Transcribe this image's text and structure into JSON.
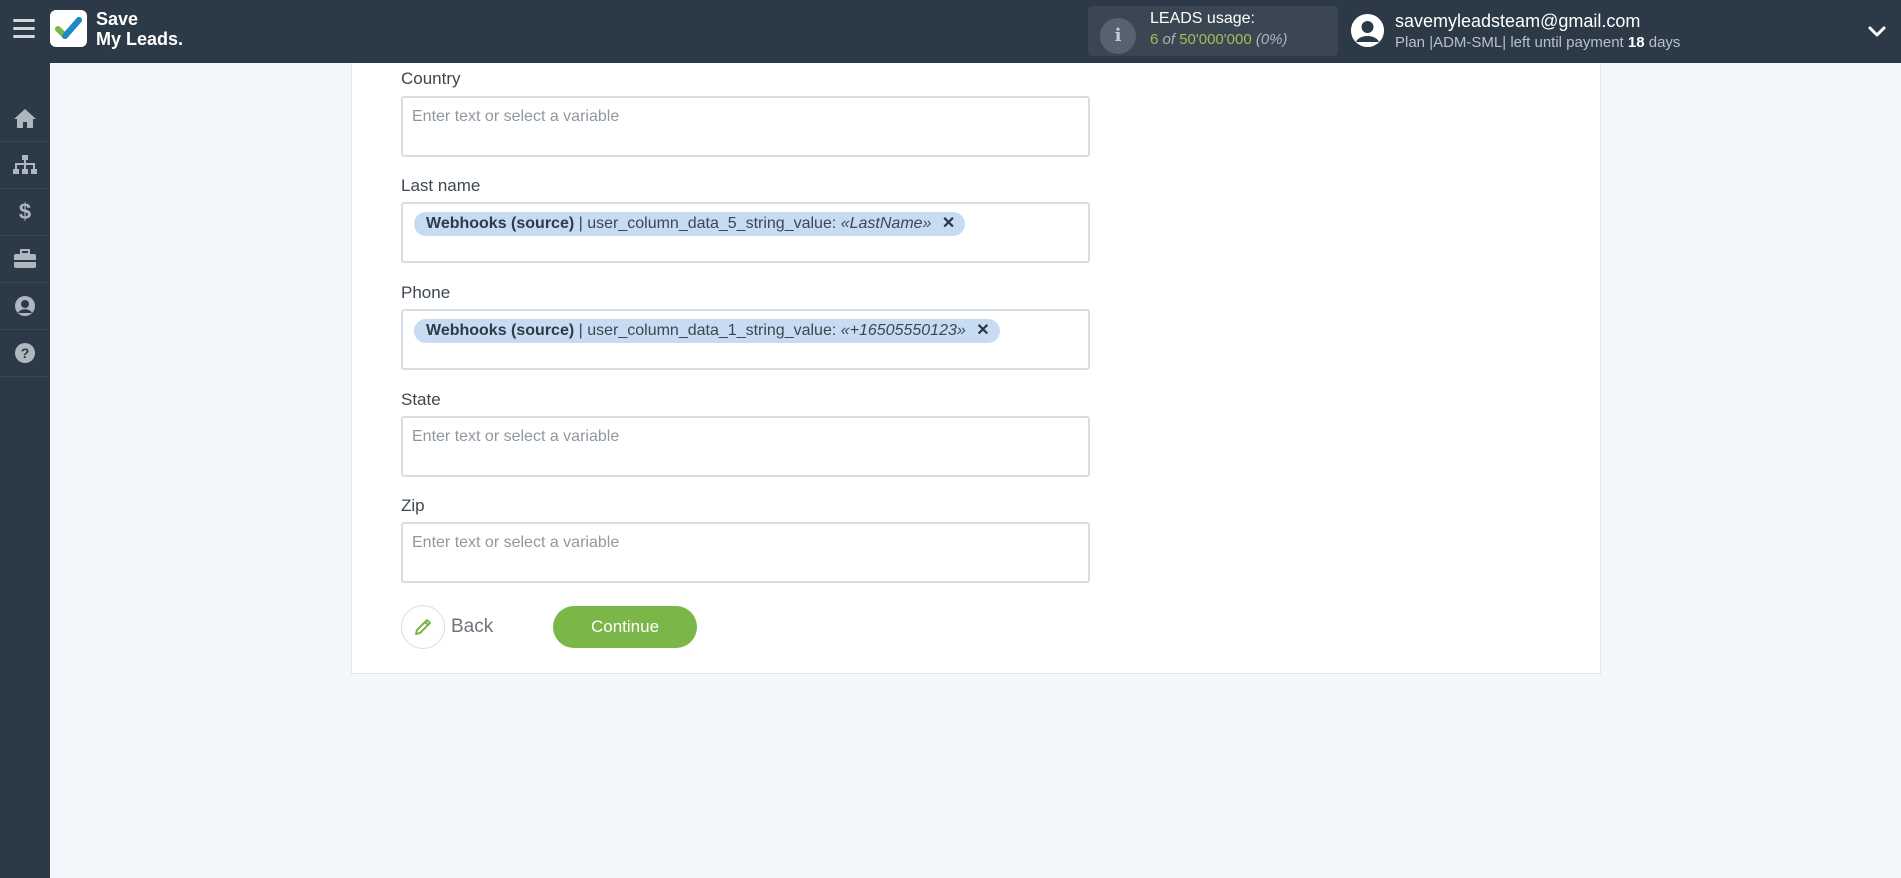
{
  "header": {
    "logo_line1": "Save",
    "logo_line2": "My Leads.",
    "usage_title": "LEADS usage:",
    "usage_used": "6",
    "usage_of": "of",
    "usage_limit": "50'000'000",
    "usage_percent": "(0%)",
    "user_email": "savemyleadsteam@gmail.com",
    "plan_text": "Plan |ADM-SML| left until payment",
    "plan_days": "18",
    "plan_days_unit": "days"
  },
  "sidebar": {
    "items": [
      {
        "icon": "home-icon"
      },
      {
        "icon": "sitemap-icon"
      },
      {
        "icon": "dollar-icon"
      },
      {
        "icon": "briefcase-icon"
      },
      {
        "icon": "user-icon"
      },
      {
        "icon": "help-icon"
      }
    ]
  },
  "form": {
    "fields": [
      {
        "label": "Country",
        "placeholder": "Enter text or select a variable"
      },
      {
        "label": "Last name",
        "chip_source": "Webhooks (source)",
        "chip_sep": "| user_column_data_5_string_value:",
        "chip_value": "«LastName»",
        "chip_remove": "✕"
      },
      {
        "label": "Phone",
        "chip_source": "Webhooks (source)",
        "chip_sep": "| user_column_data_1_string_value:",
        "chip_value": "«+16505550123»",
        "chip_remove": "✕"
      },
      {
        "label": "State",
        "placeholder": "Enter text or select a variable"
      },
      {
        "label": "Zip",
        "placeholder": "Enter text or select a variable"
      }
    ],
    "back_label": "Back",
    "continue_label": "Continue"
  },
  "colors": {
    "topbar": "#2c3a47",
    "accent_green": "#7ab648",
    "chip_bg": "#c7dcf2"
  }
}
